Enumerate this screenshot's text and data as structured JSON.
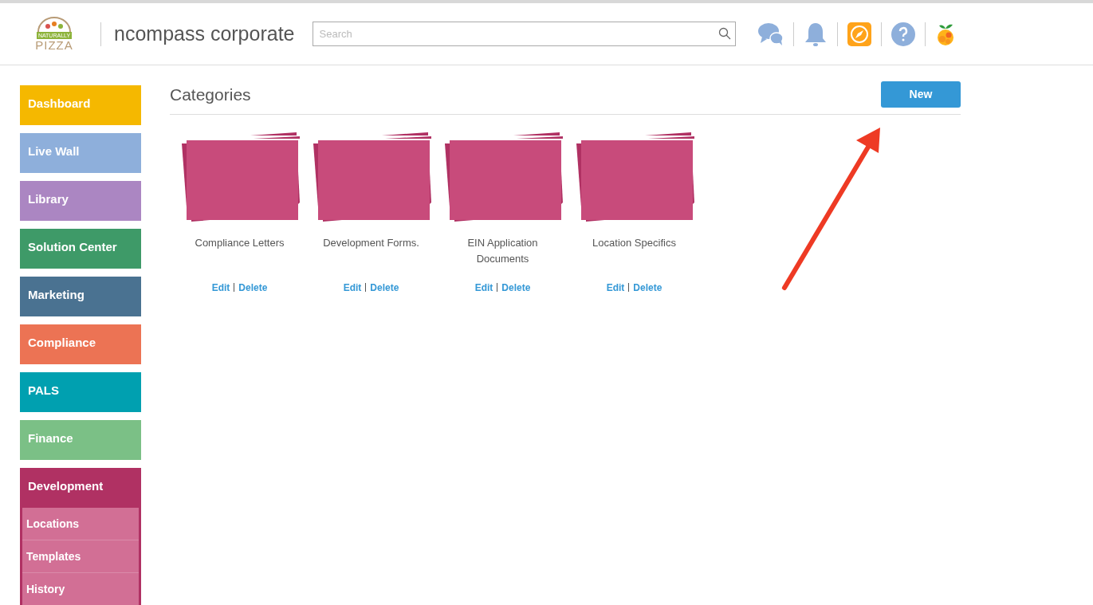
{
  "header": {
    "logo": {
      "top": "NATURALLY",
      "bottom": "PIZZA"
    },
    "title": "ncompass corporate",
    "search": {
      "placeholder": "Search"
    }
  },
  "sidebar": {
    "items": [
      {
        "label": "Dashboard",
        "color": "#f5b800",
        "expanded": false
      },
      {
        "label": "Live Wall",
        "color": "#8eafdb",
        "expanded": false
      },
      {
        "label": "Library",
        "color": "#ab86c2",
        "expanded": false
      },
      {
        "label": "Solution Center",
        "color": "#3e9a68",
        "expanded": false
      },
      {
        "label": "Marketing",
        "color": "#4a7291",
        "expanded": false
      },
      {
        "label": "Compliance",
        "color": "#ec7354",
        "expanded": false
      },
      {
        "label": "PALS",
        "color": "#00a0b0",
        "expanded": false
      },
      {
        "label": "Finance",
        "color": "#7bc086",
        "expanded": false
      },
      {
        "label": "Development",
        "color": "#b03163",
        "expanded": true,
        "children": [
          {
            "label": "Locations"
          },
          {
            "label": "Templates"
          },
          {
            "label": "History"
          }
        ]
      }
    ]
  },
  "main": {
    "title": "Categories",
    "new_button": "New",
    "categories": [
      {
        "name": "Compliance Letters",
        "edit": "Edit",
        "delete": "Delete"
      },
      {
        "name": "Development Forms.",
        "edit": "Edit",
        "delete": "Delete"
      },
      {
        "name": "EIN Application Documents",
        "edit": "Edit",
        "delete": "Delete"
      },
      {
        "name": "Location Specifics",
        "edit": "Edit",
        "delete": "Delete"
      }
    ]
  }
}
